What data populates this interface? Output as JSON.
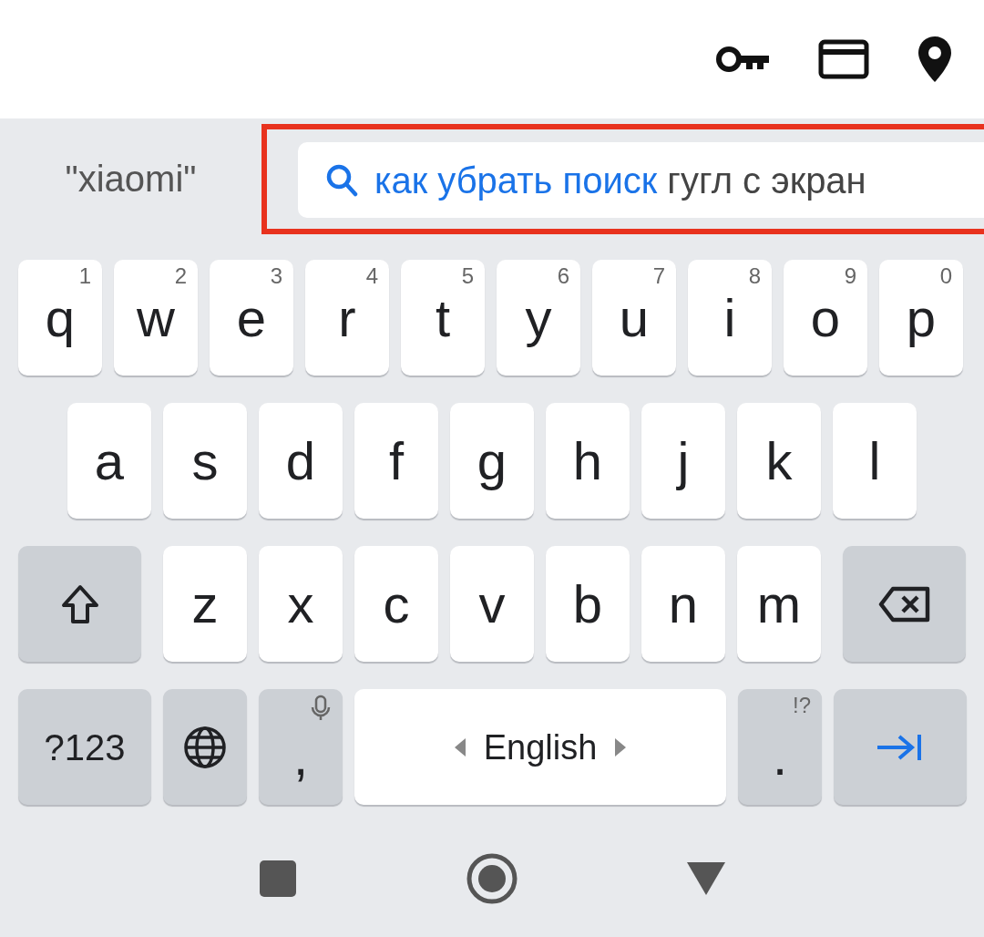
{
  "top_bar": {
    "icons": [
      {
        "kind": "key"
      },
      {
        "kind": "card"
      },
      {
        "kind": "pin"
      }
    ]
  },
  "suggestions": [
    {
      "kind": "plain",
      "text": "\"xiaomi\""
    },
    {
      "kind": "search",
      "typed": "как убрать поиск",
      "completion": "гугл с экран",
      "highlighted": true
    }
  ],
  "keyboard": {
    "rows": [
      {
        "keys": [
          {
            "kind": "letter",
            "label": "q",
            "hint": "1"
          },
          {
            "kind": "letter",
            "label": "w",
            "hint": "2"
          },
          {
            "kind": "letter",
            "label": "e",
            "hint": "3"
          },
          {
            "kind": "letter",
            "label": "r",
            "hint": "4"
          },
          {
            "kind": "letter",
            "label": "t",
            "hint": "5"
          },
          {
            "kind": "letter",
            "label": "y",
            "hint": "6"
          },
          {
            "kind": "letter",
            "label": "u",
            "hint": "7"
          },
          {
            "kind": "letter",
            "label": "i",
            "hint": "8"
          },
          {
            "kind": "letter",
            "label": "o",
            "hint": "9"
          },
          {
            "kind": "letter",
            "label": "p",
            "hint": "0"
          }
        ]
      },
      {
        "keys": [
          {
            "kind": "letter",
            "label": "a"
          },
          {
            "kind": "letter",
            "label": "s"
          },
          {
            "kind": "letter",
            "label": "d"
          },
          {
            "kind": "letter",
            "label": "f"
          },
          {
            "kind": "letter",
            "label": "g"
          },
          {
            "kind": "letter",
            "label": "h"
          },
          {
            "kind": "letter",
            "label": "j"
          },
          {
            "kind": "letter",
            "label": "k"
          },
          {
            "kind": "letter",
            "label": "l"
          }
        ]
      },
      {
        "keys": [
          {
            "kind": "shift"
          },
          {
            "kind": "letter",
            "label": "z"
          },
          {
            "kind": "letter",
            "label": "x"
          },
          {
            "kind": "letter",
            "label": "c"
          },
          {
            "kind": "letter",
            "label": "v"
          },
          {
            "kind": "letter",
            "label": "b"
          },
          {
            "kind": "letter",
            "label": "n"
          },
          {
            "kind": "letter",
            "label": "m"
          },
          {
            "kind": "backspace"
          }
        ]
      },
      {
        "keys": [
          {
            "kind": "symbols",
            "label": "?123"
          },
          {
            "kind": "globe"
          },
          {
            "kind": "comma",
            "label": ","
          },
          {
            "kind": "space",
            "label": "English"
          },
          {
            "kind": "period",
            "label": ".",
            "hint": "!?"
          },
          {
            "kind": "enter"
          }
        ]
      }
    ]
  },
  "nav_bar": [
    {
      "kind": "recents"
    },
    {
      "kind": "home"
    },
    {
      "kind": "back"
    }
  ]
}
